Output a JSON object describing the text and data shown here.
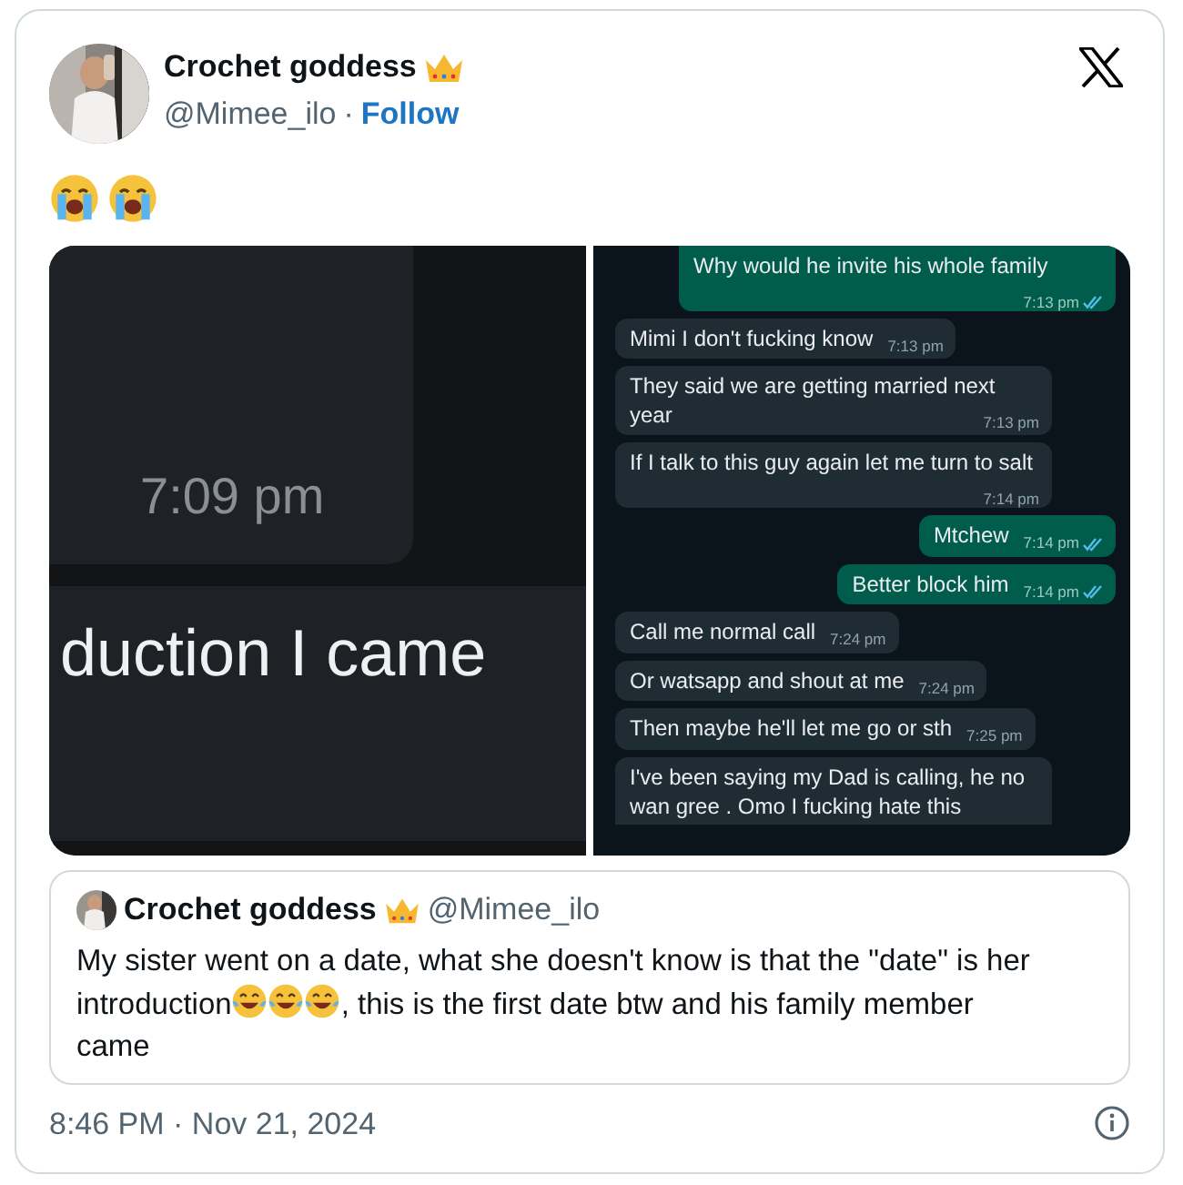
{
  "author": {
    "name": "Crochet goddess",
    "handle": "@Mimee_ilo",
    "separator": "·",
    "follow": "Follow"
  },
  "tweet_emojis": [
    {
      "kind": "crying"
    },
    {
      "kind": "crying"
    }
  ],
  "left_screenshot": {
    "time": "7:09 pm",
    "text": "duction I came"
  },
  "chat": [
    {
      "kind": "out",
      "text": "Why would he invite his whole family",
      "time": "7:13 pm",
      "read": true
    },
    {
      "kind": "in",
      "text": "Mimi I don't fucking know",
      "time": "7:13 pm"
    },
    {
      "kind": "in",
      "text": "They said we are getting married next year",
      "time": "7:13 pm"
    },
    {
      "kind": "in",
      "text": "If I talk to this guy again let me turn to salt",
      "time": "7:14 pm"
    },
    {
      "kind": "out",
      "text": "Mtchew",
      "time": "7:14 pm",
      "read": true
    },
    {
      "kind": "out",
      "text": "Better block him",
      "time": "7:14 pm",
      "read": true
    },
    {
      "kind": "in",
      "text": "Call me normal call",
      "time": "7:24 pm"
    },
    {
      "kind": "in",
      "text": "Or watsapp and shout at me",
      "time": "7:24 pm"
    },
    {
      "kind": "in",
      "text": "Then maybe he'll let me go or sth",
      "time": "7:25 pm"
    },
    {
      "kind": "in",
      "text": "I've been saying my Dad is calling, he no wan gree . Omo I fucking hate this"
    }
  ],
  "quote": {
    "name": "Crochet goddess",
    "handle": "@Mimee_ilo",
    "body": [
      {
        "kind": "text",
        "text": "My sister went on a date, what she doesn't know is that the \"date\" is her introduction"
      },
      {
        "kind": "laughing"
      },
      {
        "kind": "laughing"
      },
      {
        "kind": "laughing"
      },
      {
        "kind": "text",
        "text": ", this is the first date btw and his family member came"
      }
    ]
  },
  "timestamp": "8:46 PM · Nov 21, 2024"
}
